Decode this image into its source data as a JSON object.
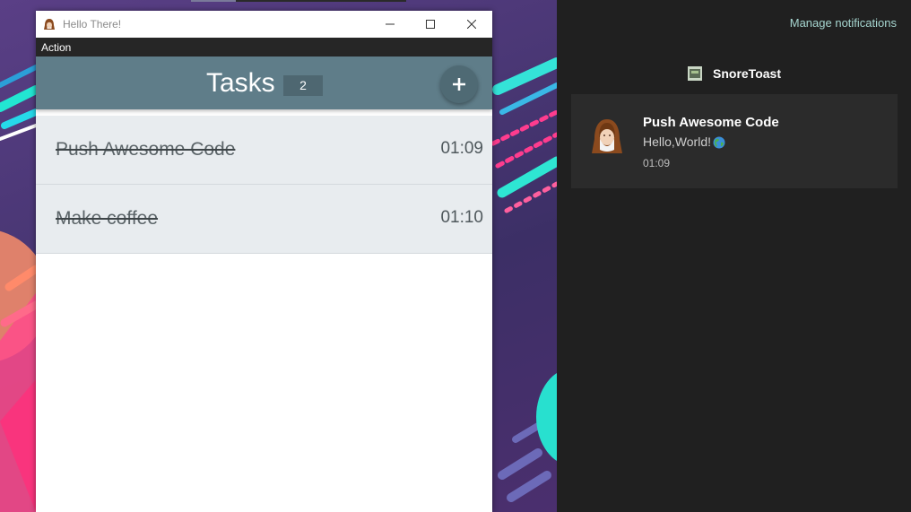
{
  "window": {
    "title": "Hello There!",
    "icons": {
      "app": "hooded-avatar-icon",
      "minimize": "minimize-icon",
      "maximize": "maximize-icon",
      "close": "close-icon"
    }
  },
  "menu": {
    "items": [
      {
        "label": "Action"
      }
    ]
  },
  "header": {
    "title": "Tasks",
    "count": "2",
    "add_icon": "plus-icon"
  },
  "tasks": [
    {
      "name": "Push Awesome Code",
      "time": "01:09",
      "completed": true
    },
    {
      "name": "Make coffee",
      "time": "01:10",
      "completed": true
    }
  ],
  "action_center": {
    "manage_label": "Manage notifications",
    "group_name": "SnoreToast",
    "group_icon": "snoretoast-app-icon",
    "toast": {
      "title": "Push Awesome Code",
      "body": "Hello,World!",
      "body_emoji": "globe-icon",
      "time": "01:09",
      "avatar": "hooded-avatar-icon"
    }
  },
  "colors": {
    "header_bg": "#5f7d89",
    "count_bg": "#4e6771",
    "add_button_bg": "#4f6a74",
    "task_row_bg": "#e8ecef",
    "action_center_bg": "#202020",
    "toast_bg": "#2b2b2b",
    "manage_link": "#a6d6d0"
  }
}
